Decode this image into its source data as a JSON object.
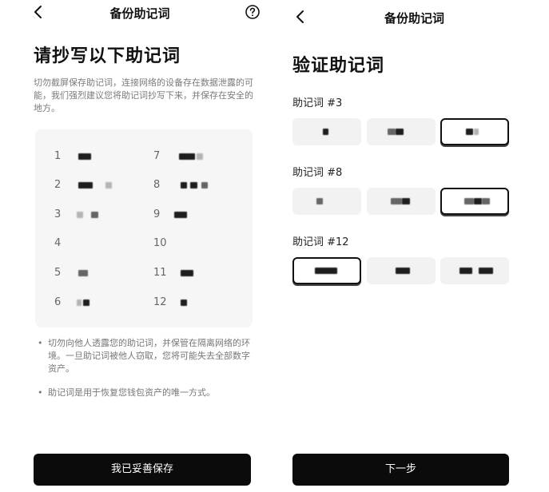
{
  "left": {
    "header_title": "备份助记词",
    "title": "请抄写以下助记词",
    "description": "切勿截屏保存助记词，连接网络的设备存在数据泄露的可能，我们强烈建议您将助记词抄写下来，并保存在安全的地方。",
    "words": [
      {
        "num": "1"
      },
      {
        "num": "2"
      },
      {
        "num": "3"
      },
      {
        "num": "4"
      },
      {
        "num": "5"
      },
      {
        "num": "6"
      },
      {
        "num": "7"
      },
      {
        "num": "8"
      },
      {
        "num": "9"
      },
      {
        "num": "10"
      },
      {
        "num": "11"
      },
      {
        "num": "12"
      }
    ],
    "bullets": [
      {
        "dot": "•",
        "text": "切勿向他人透露您的助记词，并保管在隔离网络的环境。一旦助记词被他人窃取，您将可能失去全部数字资产。"
      },
      {
        "dot": "•",
        "text": "助记词是用于恢复您钱包资产的唯一方式。"
      }
    ],
    "button_label": "我已妥善保存"
  },
  "right": {
    "header_title": "备份助记词",
    "title": "验证助记词",
    "groups": [
      {
        "label": "助记词 #3",
        "selected_index": 2
      },
      {
        "label": "助记词 #8",
        "selected_index": 2
      },
      {
        "label": "助记词 #12",
        "selected_index": 0
      }
    ],
    "button_label": "下一步"
  },
  "icons": {
    "back": "chevron-left-icon",
    "help": "question-circle-icon"
  },
  "colors": {
    "primary_button": "#0b0b0b",
    "word_box": "#f6f6f6",
    "option_bg": "#f2f2f2"
  }
}
